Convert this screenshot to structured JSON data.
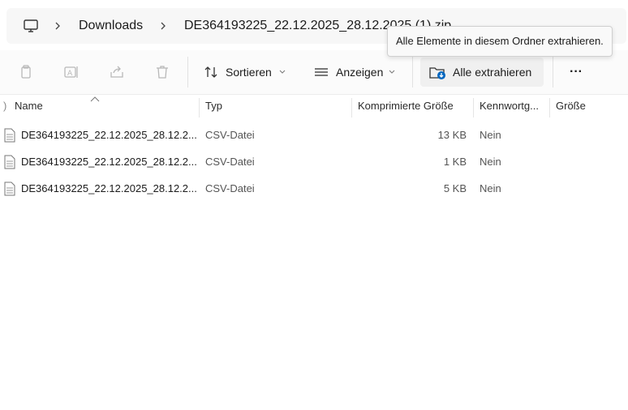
{
  "address_bar": {
    "icon": "this-pc-icon",
    "breadcrumbs": [
      "Downloads",
      "DE364193225_22.12.2025_28.12.2025 (1).zip"
    ]
  },
  "tooltip": {
    "text": "Alle Elemente in diesem Ordner extrahieren."
  },
  "toolbar": {
    "icons": [
      "copy-icon",
      "rename-icon",
      "share-icon",
      "delete-icon"
    ],
    "sort_label": "Sortieren",
    "view_label": "Anzeigen",
    "extract_label": "Alle extrahieren",
    "more_label": "···"
  },
  "columns": {
    "name": "Name",
    "type": "Typ",
    "compressed_size": "Komprimierte Größe",
    "password": "Kennwortg...",
    "size": "Größe"
  },
  "files": [
    {
      "name": "DE364193225_22.12.2025_28.12.2...",
      "type": "CSV-Datei",
      "compressed_size": "13 KB",
      "password": "Nein",
      "size": ""
    },
    {
      "name": "DE364193225_22.12.2025_28.12.2...",
      "type": "CSV-Datei",
      "compressed_size": "1 KB",
      "password": "Nein",
      "size": ""
    },
    {
      "name": "DE364193225_22.12.2025_28.12.2...",
      "type": "CSV-Datei",
      "compressed_size": "5 KB",
      "password": "Nein",
      "size": ""
    }
  ],
  "colors": {
    "accent": "#0067c0",
    "background": "#ffffff",
    "toolbar_bg": "#fbfbfb"
  }
}
